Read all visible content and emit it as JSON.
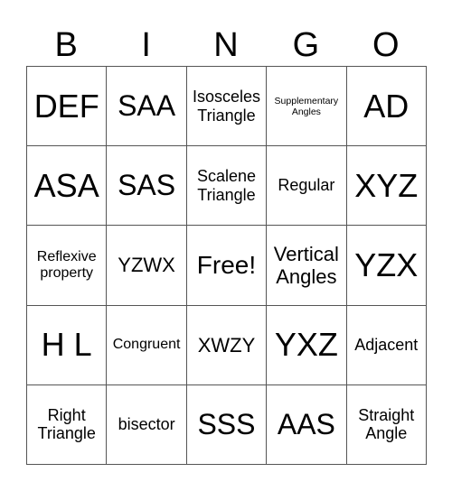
{
  "header": [
    "B",
    "I",
    "N",
    "G",
    "O"
  ],
  "rows": [
    [
      {
        "text": "DEF",
        "size": "s40"
      },
      {
        "text": "SAA",
        "size": "s34"
      },
      {
        "text": "Isosceles Triangle",
        "size": "s19"
      },
      {
        "text": "Supplementary Angles",
        "size": "s11"
      },
      {
        "text": "AD",
        "size": "s40"
      }
    ],
    [
      {
        "text": "ASA",
        "size": "s40"
      },
      {
        "text": "SAS",
        "size": "s34"
      },
      {
        "text": "Scalene Triangle",
        "size": "s19"
      },
      {
        "text": "Regular",
        "size": "s19"
      },
      {
        "text": "XYZ",
        "size": "s40"
      }
    ],
    [
      {
        "text": "Reflexive property",
        "size": "s16"
      },
      {
        "text": "YZWX",
        "size": "s24"
      },
      {
        "text": "Free!",
        "size": "s28"
      },
      {
        "text": "Vertical Angles",
        "size": "s24"
      },
      {
        "text": "YZX",
        "size": "s40"
      }
    ],
    [
      {
        "text": "H L",
        "size": "s40"
      },
      {
        "text": "Congruent",
        "size": "s16"
      },
      {
        "text": "XWZY",
        "size": "s24"
      },
      {
        "text": "YXZ",
        "size": "s40"
      },
      {
        "text": "Adjacent",
        "size": "s19"
      }
    ],
    [
      {
        "text": "Right Triangle",
        "size": "s19"
      },
      {
        "text": "bisector",
        "size": "s19"
      },
      {
        "text": "SSS",
        "size": "s34"
      },
      {
        "text": "AAS",
        "size": "s34"
      },
      {
        "text": "Straight Angle",
        "size": "s19"
      }
    ]
  ]
}
